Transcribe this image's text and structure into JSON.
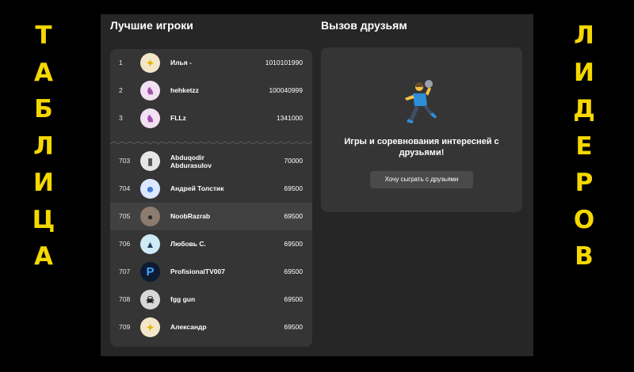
{
  "decor": {
    "left_letters": [
      "Т",
      "А",
      "Б",
      "Л",
      "И",
      "Ц",
      "А"
    ],
    "right_letters": [
      "Л",
      "И",
      "Д",
      "Е",
      "Р",
      "О",
      "В"
    ]
  },
  "leaderboard": {
    "title": "Лучшие игроки",
    "rows": [
      {
        "rank": "1",
        "name": "Илья -",
        "score": "1010101990",
        "avatar_icon": "sparkle-icon"
      },
      {
        "rank": "2",
        "name": "hehketzz",
        "score": "100040999",
        "avatar_icon": "unicorn-icon"
      },
      {
        "rank": "3",
        "name": "FLLz",
        "score": "1341000",
        "avatar_icon": "unicorn-icon"
      },
      {
        "rank": "703",
        "name": "Abduqodir Abdurasulov",
        "score": "70000",
        "avatar_icon": "building-icon"
      },
      {
        "rank": "704",
        "name": "Андрей Толстик",
        "score": "69500",
        "avatar_icon": "robot-icon"
      },
      {
        "rank": "705",
        "name": "NoobRazrab",
        "score": "69500",
        "avatar_icon": "user-photo-icon"
      },
      {
        "rank": "706",
        "name": "Любовь С.",
        "score": "69500",
        "avatar_icon": "graduation-cap-icon"
      },
      {
        "rank": "707",
        "name": "ProfisionalTV007",
        "score": "69500",
        "avatar_icon": "letter-p-icon"
      },
      {
        "rank": "708",
        "name": "fgg gun",
        "score": "69500",
        "avatar_icon": "skull-icon"
      },
      {
        "rank": "709",
        "name": "Александр",
        "score": "69500",
        "avatar_icon": "sparkle-icon"
      }
    ],
    "highlighted_rank": "705"
  },
  "friends": {
    "title": "Вызов друзьям",
    "message": "Игры и соревнования интересней с друзьями!",
    "button_label": "Хочу сыграть с друзьями",
    "illustration_icon": "person-playing-handball-icon"
  }
}
